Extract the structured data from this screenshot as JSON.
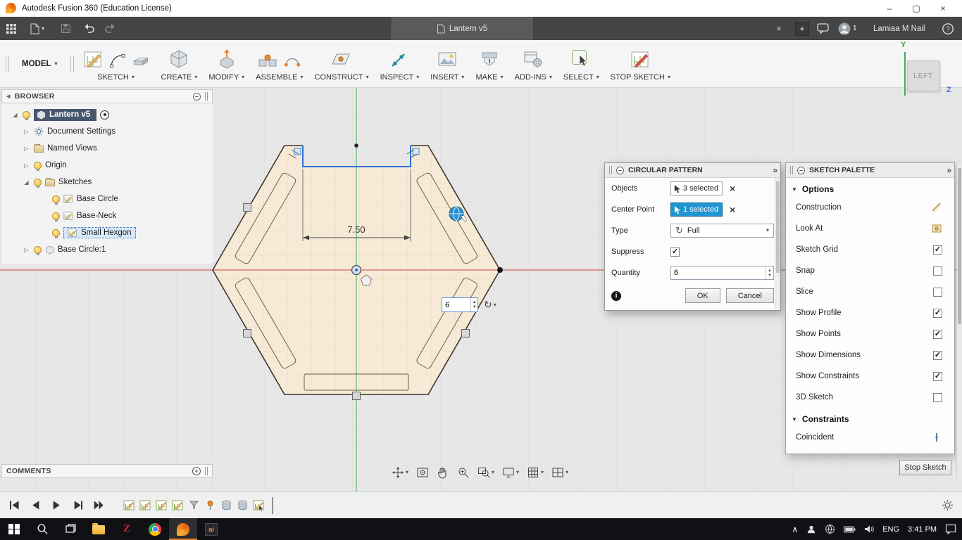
{
  "title_bar": {
    "title": "Autodesk Fusion 360 (Education License)"
  },
  "tab_bar": {
    "document_tab": "Lantern v5",
    "user_name": "Lamiaa M Nail",
    "user_badge": "1"
  },
  "toolbar": {
    "workspace": "MODEL",
    "menus": [
      {
        "label": "SKETCH"
      },
      {
        "label": "CREATE"
      },
      {
        "label": "MODIFY"
      },
      {
        "label": "ASSEMBLE"
      },
      {
        "label": "CONSTRUCT"
      },
      {
        "label": "INSPECT"
      },
      {
        "label": "INSERT"
      },
      {
        "label": "MAKE"
      },
      {
        "label": "ADD-INS"
      },
      {
        "label": "SELECT"
      },
      {
        "label": "STOP SKETCH"
      }
    ]
  },
  "viewcube": {
    "face": "LEFT",
    "axis_y": "Y",
    "axis_z": "Z"
  },
  "browser": {
    "header": "BROWSER",
    "root_label": "Lantern v5",
    "items": [
      {
        "label": "Document Settings",
        "icon": "gear",
        "expandable": true
      },
      {
        "label": "Named Views",
        "icon": "folder",
        "expandable": true
      },
      {
        "label": "Origin",
        "icon": "bulb",
        "expandable": true
      },
      {
        "label": "Sketches",
        "icon": "folder",
        "expanded": true
      },
      {
        "label": "Base Circle",
        "icon": "sketch"
      },
      {
        "label": "Base-Neck",
        "icon": "sketch"
      },
      {
        "label": "Small Hexgon",
        "icon": "sketch",
        "selected": true
      },
      {
        "label": "Base Circle:1",
        "icon": "body",
        "expandable": true
      }
    ]
  },
  "canvas": {
    "dimension": "7.50",
    "quantity": "6"
  },
  "pattern_dialog": {
    "title": "CIRCULAR PATTERN",
    "objects_label": "Objects",
    "objects_value": "3 selected",
    "center_label": "Center Point",
    "center_value": "1 selected",
    "type_label": "Type",
    "type_value": "Full",
    "suppress_label": "Suppress",
    "suppress_checked": true,
    "quantity_label": "Quantity",
    "quantity_value": "6",
    "ok": "OK",
    "cancel": "Cancel"
  },
  "sketch_palette": {
    "title": "SKETCH PALETTE",
    "options_header": "Options",
    "options": [
      {
        "label": "Construction",
        "control": "icon"
      },
      {
        "label": "Look At",
        "control": "icon"
      },
      {
        "label": "Sketch Grid",
        "control": "checkbox",
        "checked": true
      },
      {
        "label": "Snap",
        "control": "checkbox",
        "checked": false
      },
      {
        "label": "Slice",
        "control": "checkbox",
        "checked": false
      },
      {
        "label": "Show Profile",
        "control": "checkbox",
        "checked": true
      },
      {
        "label": "Show Points",
        "control": "checkbox",
        "checked": true
      },
      {
        "label": "Show Dimensions",
        "control": "checkbox",
        "checked": true
      },
      {
        "label": "Show Constraints",
        "control": "checkbox",
        "checked": true
      },
      {
        "label": "3D Sketch",
        "control": "checkbox",
        "checked": false
      }
    ],
    "constraints_header": "Constraints",
    "constraints": [
      {
        "label": "Coincident",
        "control": "icon"
      }
    ],
    "stop_sketch": "Stop Sketch"
  },
  "comments": {
    "header": "COMMENTS"
  },
  "navbar": {
    "icons": [
      "orbit-pan",
      "look-at",
      "pan-hand",
      "zoom",
      "zoom-window",
      "display-settings",
      "grid-snap",
      "viewports"
    ]
  },
  "timeline": {
    "playback": [
      "go-to-start",
      "step-back",
      "play",
      "step-forward",
      "go-to-end"
    ],
    "features": [
      "sketch",
      "sketch",
      "sketch",
      "sketch",
      "funnel",
      "pin",
      "cylinder",
      "cylinder",
      "sketch"
    ]
  },
  "taskbar": {
    "apps": [
      "start",
      "search",
      "task-view",
      "file-explorer",
      "zotero",
      "chrome",
      "fusion-360",
      "dark-app"
    ],
    "tray": [
      "hidden-icons",
      "person",
      "network",
      "battery",
      "volume"
    ],
    "language": "ENG",
    "time": "3:41 PM"
  }
}
